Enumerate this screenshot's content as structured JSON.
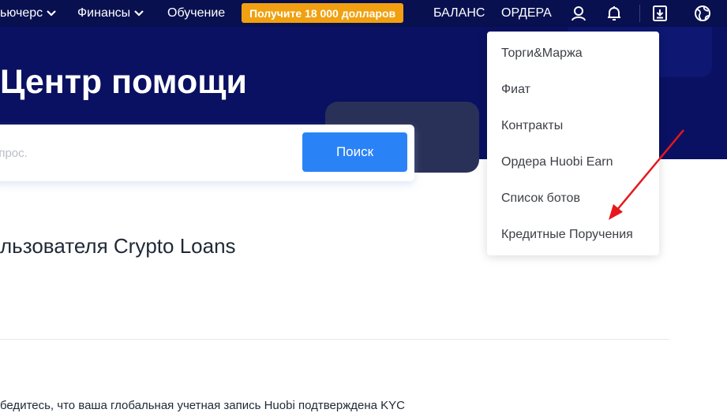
{
  "nav": {
    "futures_label": "ьючерс",
    "finance_label": "Финансы",
    "learning_label": "Обучение",
    "promo_label": "Получите 18 000 долларов",
    "balance_label": "БАЛАНС",
    "orders_label": "ОРДЕРА",
    "icons": [
      "user-icon",
      "bell-icon",
      "download-icon",
      "globe-icon"
    ]
  },
  "hero": {
    "title": "Центр помощи"
  },
  "search": {
    "placeholder": "опрос.",
    "button_label": "Поиск"
  },
  "article": {
    "title": "льзователя Crypto Loans",
    "body_text": "бедитесь, что ваша глобальная учетная запись Huobi подтверждена KYC"
  },
  "orders_menu": {
    "items": [
      "Торги&Маржа",
      "Фиат",
      "Контракты",
      "Ордера Huobi Earn",
      "Список ботов",
      "Кредитные Поручения"
    ]
  },
  "colors": {
    "hero_bg": "#0a1162",
    "topnav_bg": "#08104f",
    "promo_bg": "#f0a010",
    "search_button_bg": "#2a83f6",
    "annotation_arrow": "#e8171c"
  }
}
